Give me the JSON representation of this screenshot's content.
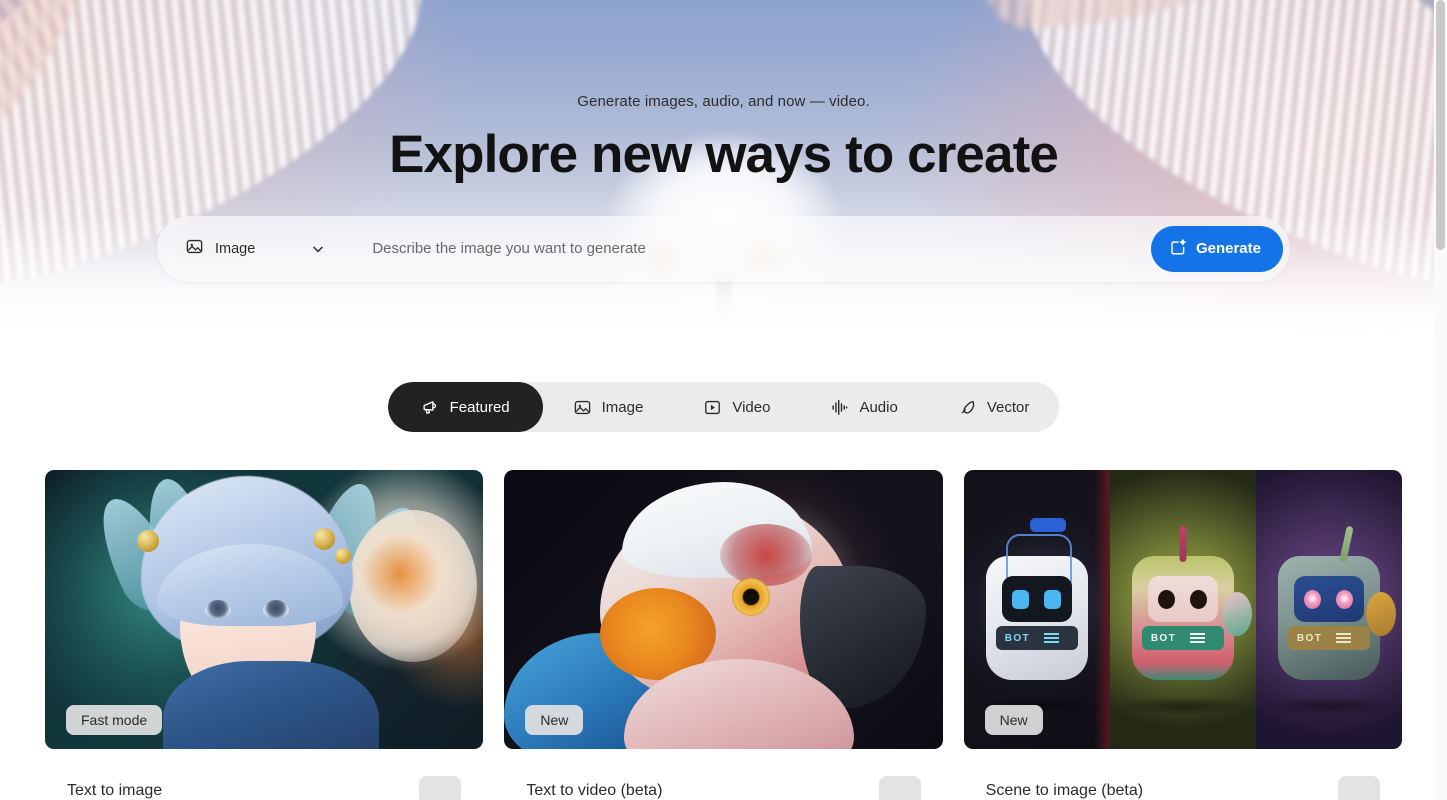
{
  "hero": {
    "subtitle": "Generate images, audio, and now — video.",
    "title": "Explore new ways to create"
  },
  "search": {
    "type_icon": "image-icon",
    "type_value": "Image",
    "chevron_icon": "chevron-down-icon",
    "placeholder": "Describe the image you want to generate",
    "input_value": "",
    "generate_label": "Generate",
    "generate_icon": "generate-sparkle-icon",
    "accent_color": "#1473e6"
  },
  "tabs": [
    {
      "label": "Featured",
      "icon": "megaphone-icon",
      "active": true
    },
    {
      "label": "Image",
      "icon": "image-icon",
      "active": false
    },
    {
      "label": "Video",
      "icon": "play-square-icon",
      "active": false
    },
    {
      "label": "Audio",
      "icon": "audio-waveform-icon",
      "active": false
    },
    {
      "label": "Vector",
      "icon": "pen-nib-icon",
      "active": false
    }
  ],
  "cards": [
    {
      "badge": "Fast mode",
      "title": "Text to image",
      "art": "anime character with blue hair and flowers",
      "bot_label": ""
    },
    {
      "badge": "New",
      "title": "Text to video (beta)",
      "art": "close-up of a red and white parrot",
      "bot_label": ""
    },
    {
      "badge": "New",
      "title": "Scene to image (beta)",
      "art": "three toy robots in colored panels",
      "bot_label": "BOT"
    }
  ]
}
